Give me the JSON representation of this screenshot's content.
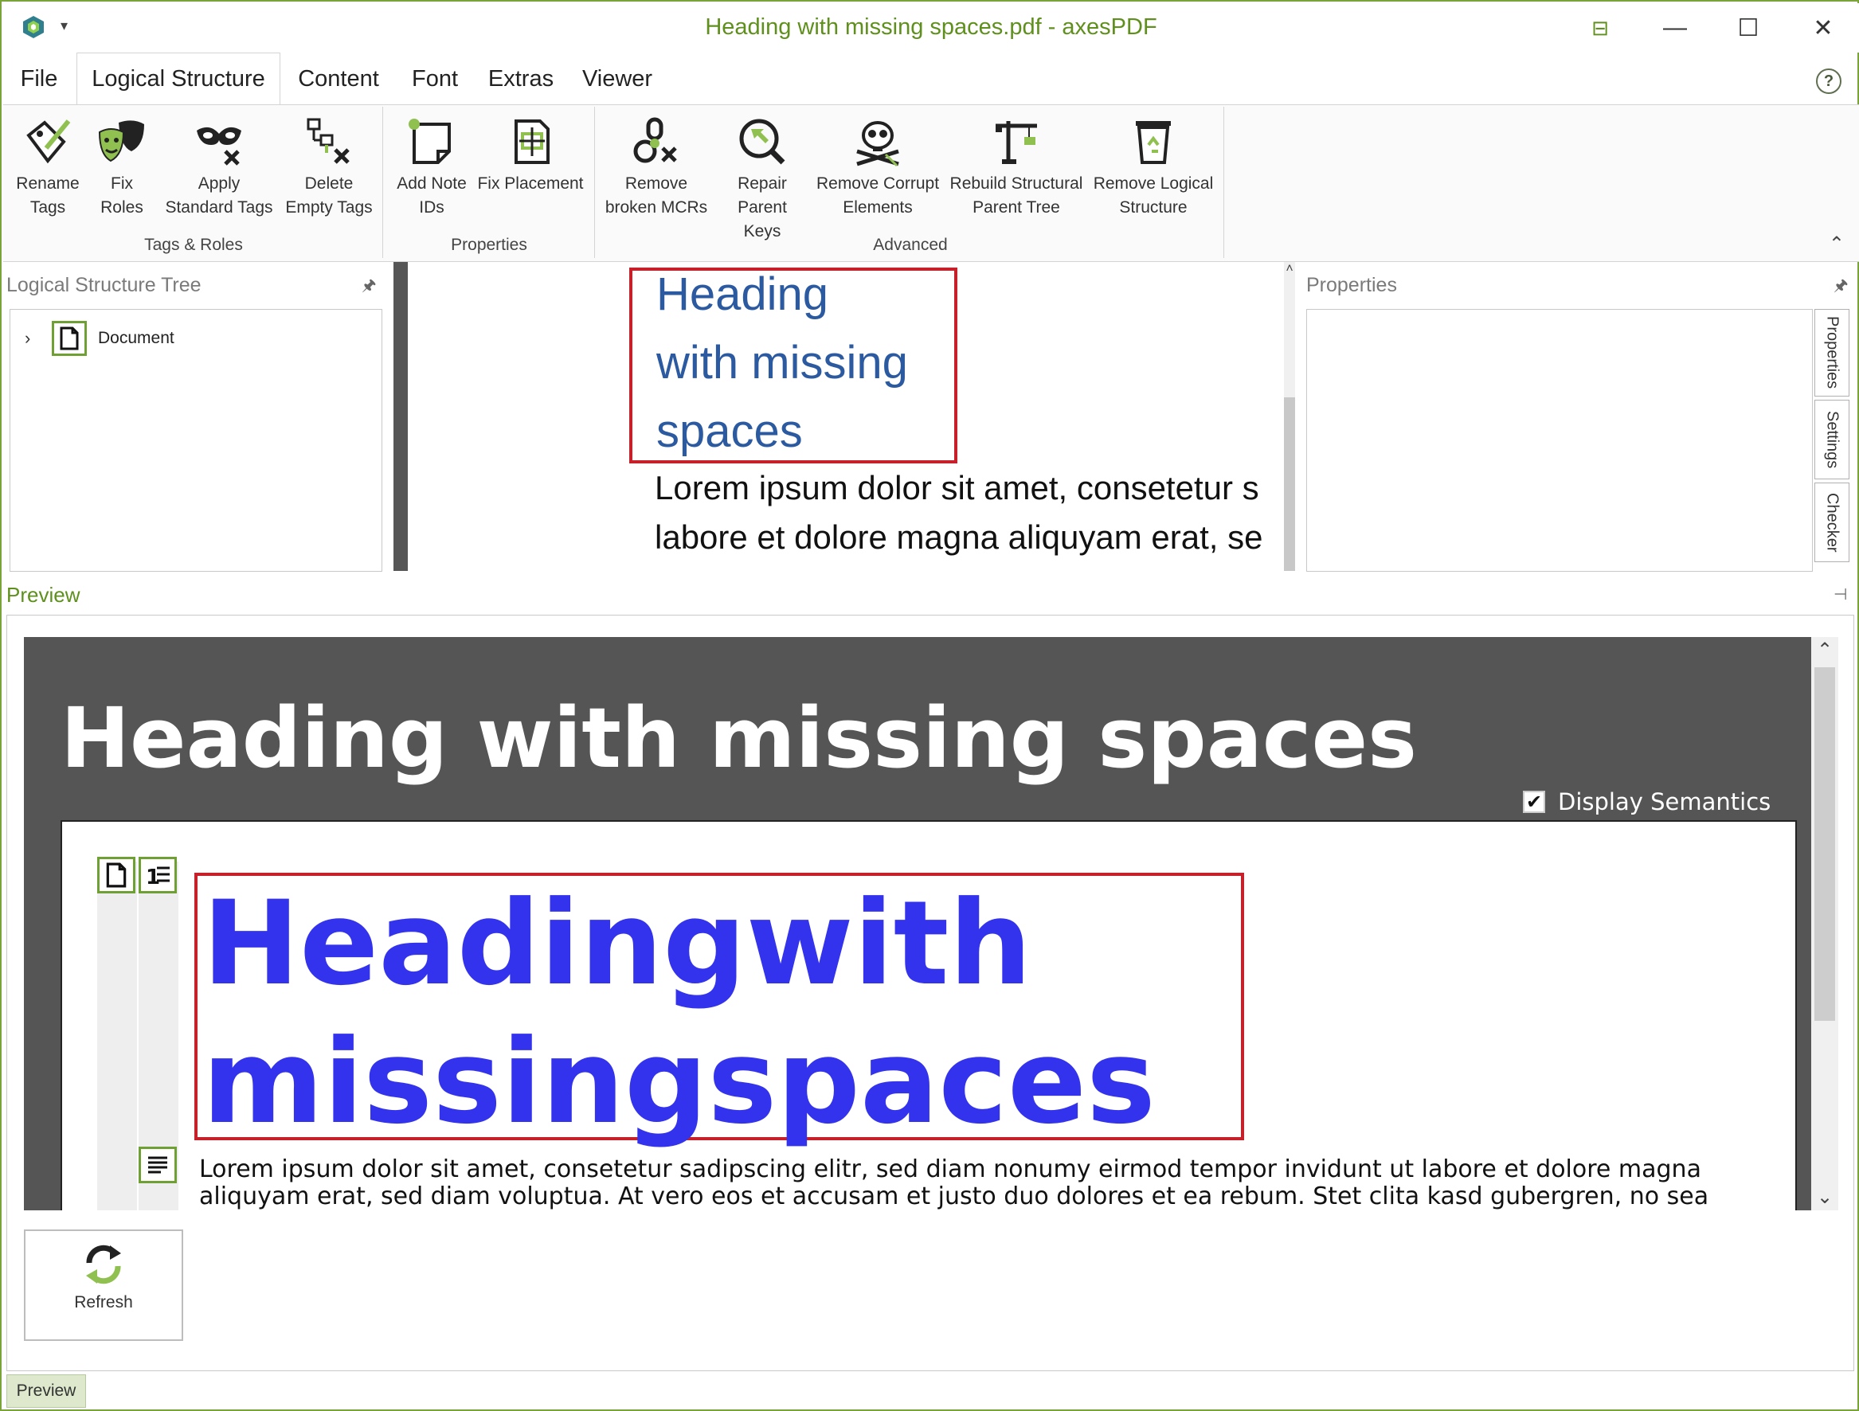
{
  "window": {
    "title": "Heading with missing spaces.pdf - axesPDF",
    "qa_arrow": "▾",
    "pin_glyph": "⊟",
    "min_glyph": "—",
    "max_glyph": "☐",
    "close_glyph": "✕"
  },
  "menu": {
    "tabs": [
      {
        "label": "File"
      },
      {
        "label": "Logical Structure"
      },
      {
        "label": "Content"
      },
      {
        "label": "Font"
      },
      {
        "label": "Extras"
      },
      {
        "label": "Viewer"
      }
    ],
    "help": "?"
  },
  "ribbon": {
    "buttons": [
      {
        "line1": "Rename",
        "line2": "Tags"
      },
      {
        "line1": "Fix Roles",
        "line2": ""
      },
      {
        "line1": "Apply",
        "line2": "Standard Tags"
      },
      {
        "line1": "Delete",
        "line2": "Empty Tags"
      },
      {
        "line1": "Add Note",
        "line2": "IDs"
      },
      {
        "line1": "Fix Placement",
        "line2": ""
      },
      {
        "line1": "Remove",
        "line2": "broken MCRs"
      },
      {
        "line1": "Repair",
        "line2": "Parent Keys"
      },
      {
        "line1": "Remove Corrupt",
        "line2": "Elements"
      },
      {
        "line1": "Rebuild Structural",
        "line2": "Parent Tree"
      },
      {
        "line1": "Remove Logical",
        "line2": "Structure"
      }
    ],
    "groups": [
      "Tags & Roles",
      "Properties",
      "Advanced"
    ],
    "collapse": "⌃"
  },
  "tree_pane": {
    "title": "Logical Structure Tree",
    "pin": "🖈",
    "items": [
      {
        "chevron": "›",
        "label": "Document"
      }
    ]
  },
  "doc_view": {
    "heading_lines": [
      "Heading",
      "with missing",
      "spaces"
    ],
    "lorem_lines": [
      "Lorem ipsum dolor sit amet, consetetur s",
      "labore et dolore magna aliquyam erat, se"
    ],
    "scroll_up": "˄"
  },
  "properties_pane": {
    "title": "Properties",
    "pin": "🖈",
    "side_tabs": [
      "Properties",
      "Settings",
      "Checker"
    ]
  },
  "preview": {
    "title": "Preview",
    "pin": "⊣",
    "big_title": "Heading with missing spaces",
    "display_semantics": {
      "label": "Display Semantics",
      "checked": true,
      "mark": "✔"
    },
    "heading_lines": [
      "Headingwith",
      "missingspaces"
    ],
    "lorem": "Lorem ipsum dolor sit amet, consetetur sadipscing elitr, sed diam nonumy eirmod tempor invidunt ut labore et dolore magna aliquyam erat, sed diam voluptua. At vero eos et accusam et justo duo dolores et ea rebum. Stet clita kasd gubergren, no sea takimata sanctus est Lorem ipsum dolor sit amet. Lorem ipsum dolor sit amet, consetetur sadipscing elitr.",
    "scroll_up": "⌃",
    "scroll_down": "⌄"
  },
  "refresh": {
    "label": "Refresh"
  },
  "bottom_tab": {
    "label": "Preview"
  },
  "colors": {
    "accent": "#7aa33a",
    "title_green": "#5f8f1c",
    "heading_blue": "#3333ee",
    "highlight_red": "#c8202a"
  }
}
